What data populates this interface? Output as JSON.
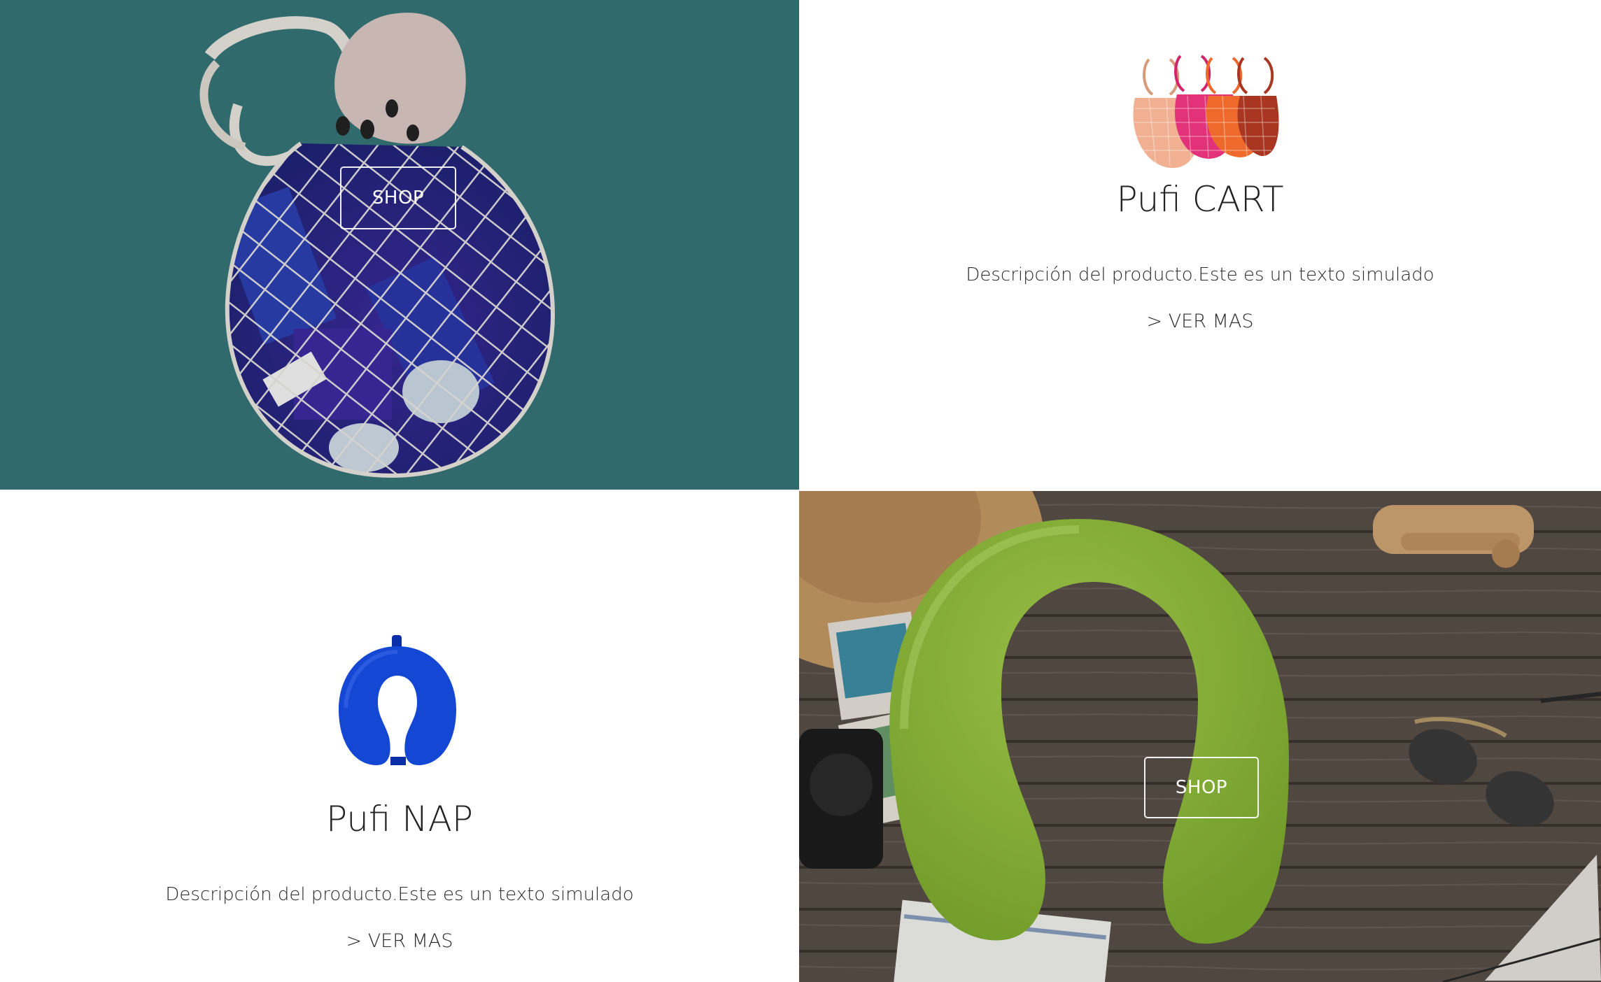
{
  "panels": {
    "cart_banner": {
      "shop_label": "SHOP"
    },
    "cart_info": {
      "title": "Pufi CART",
      "description": "Descripción del producto.Este es un texto simulado",
      "more_link": "> VER MAS"
    },
    "nap_info": {
      "title": "Pufi NAP",
      "description": "Descripción del producto.Este es un texto simulado",
      "more_link": "> VER MAS"
    },
    "nap_banner": {
      "shop_label": "SHOP"
    }
  },
  "colors": {
    "teal_background": "#357477",
    "pillow_green": "#94c43e",
    "pillow_blue": "#1447d4",
    "wood": "#5a5049"
  }
}
